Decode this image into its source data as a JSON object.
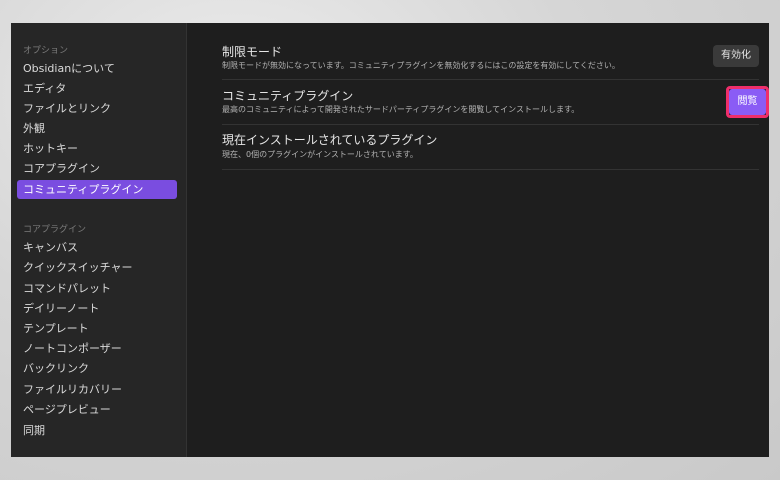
{
  "sidebar": {
    "options_title": "オプション",
    "options_items": [
      "Obsidianについて",
      "エディタ",
      "ファイルとリンク",
      "外観",
      "ホットキー",
      "コアプラグイン",
      "コミュニティプラグイン"
    ],
    "core_title": "コアプラグイン",
    "core_items": [
      "キャンバス",
      "クイックスイッチャー",
      "コマンドパレット",
      "デイリーノート",
      "テンプレート",
      "ノートコンポーザー",
      "バックリンク",
      "ファイルリカバリー",
      "ページプレビュー",
      "同期"
    ]
  },
  "settings": {
    "restricted": {
      "name": "制限モード",
      "desc": "制限モードが無効になっています。コミュニティプラグインを無効化するにはこの設定を有効にしてください。",
      "button": "有効化"
    },
    "community": {
      "name": "コミュニティプラグイン",
      "desc": "最高のコミュニティによって開発されたサードパーティプラグインを閲覧してインストールします。",
      "button": "閲覧"
    },
    "installed": {
      "name": "現在インストールされているプラグイン",
      "desc": "現在、0個のプラグインがインストールされています。"
    }
  },
  "colors": {
    "accent": "#7a4de0",
    "button_purple": "#8a5cf5",
    "highlight": "#ef2e6a"
  }
}
